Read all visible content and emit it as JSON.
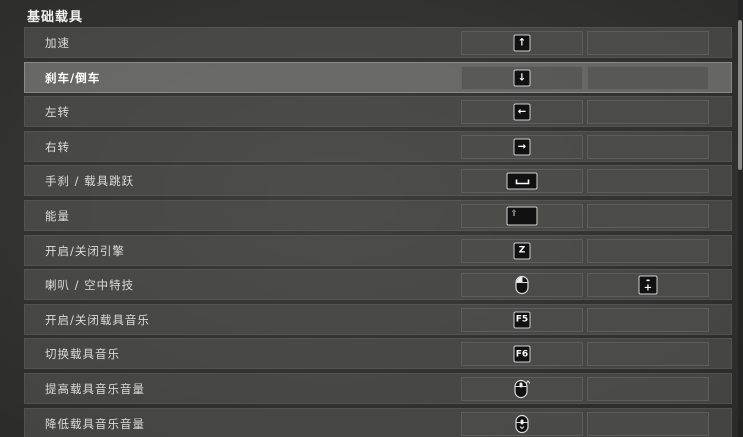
{
  "section": {
    "title": "基础载具"
  },
  "rows": [
    {
      "label": "加速",
      "primary_icon": "arrow-up-key-icon",
      "primary_symbol": "↑",
      "secondary": ""
    },
    {
      "label": "刹车/倒车",
      "primary_icon": "arrow-down-key-icon",
      "primary_symbol": "↓",
      "secondary": "",
      "selected": true
    },
    {
      "label": "左转",
      "primary_icon": "arrow-left-key-icon",
      "primary_symbol": "←",
      "secondary": ""
    },
    {
      "label": "右转",
      "primary_icon": "arrow-right-key-icon",
      "primary_symbol": "→",
      "secondary": ""
    },
    {
      "label": "手刹 / 载具跳跃",
      "primary_icon": "spacebar-key-icon",
      "primary_symbol": "␣",
      "secondary": ""
    },
    {
      "label": "能量",
      "primary_icon": "shift-key-icon",
      "primary_symbol": "⇧",
      "secondary": ""
    },
    {
      "label": "开启/关闭引擎",
      "primary_key": "Z",
      "secondary": ""
    },
    {
      "label": "喇叭 / 空中特技",
      "primary_icon": "mouse-left-click-icon",
      "secondary_icon": "mouse-wheel-button-icon",
      "secondary_text": "+"
    },
    {
      "label": "开启/关闭载具音乐",
      "primary_key": "F5",
      "secondary": ""
    },
    {
      "label": "切换载具音乐",
      "primary_key": "F6",
      "secondary": ""
    },
    {
      "label": "提高载具音乐音量",
      "primary_icon": "mouse-scroll-up-icon",
      "secondary": ""
    },
    {
      "label": "降低载具音乐音量",
      "primary_icon": "mouse-scroll-down-icon",
      "secondary": ""
    }
  ]
}
